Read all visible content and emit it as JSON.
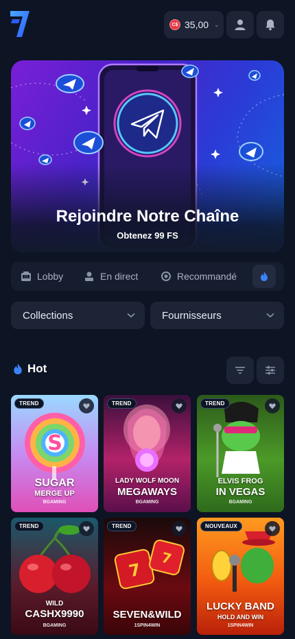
{
  "header": {
    "balance": "35,00",
    "currency_symbol": "C$"
  },
  "banner": {
    "title": "Rejoindre Notre Chaîne",
    "subtitle": "Obtenez 99 FS"
  },
  "tabs": [
    {
      "label": "Lobby",
      "icon": "slot-machine-icon"
    },
    {
      "label": "En direct",
      "icon": "dealer-icon"
    },
    {
      "label": "Recommandé",
      "icon": "medal-icon"
    },
    {
      "label": "",
      "icon": "flame-icon"
    }
  ],
  "filters": {
    "collections": "Collections",
    "providers": "Fournisseurs"
  },
  "section": {
    "title": "Hot"
  },
  "games": [
    {
      "badge": "TREND",
      "title_line1": "SUGAR",
      "title_line2": "MERGE UP",
      "provider": "BGAMING"
    },
    {
      "badge": "TREND",
      "title_line1": "LADY WOLF MOON",
      "title_line2": "MEGAWAYS",
      "provider": "BGAMING"
    },
    {
      "badge": "TREND",
      "title_line1": "ELVIS FROG",
      "title_line2": "IN VEGAS",
      "provider": "BGAMING"
    },
    {
      "badge": "TREND",
      "title_line1": "WILD",
      "title_line2": "CASHX9990",
      "provider": "BGAMING"
    },
    {
      "badge": "TREND",
      "title_line1": "",
      "title_line2": "SEVEN&WILD",
      "provider": "1SPIN4WIN"
    },
    {
      "badge": "NOUVEAUX",
      "title_line1": "LUCKY BAND",
      "title_line2": "HOLD AND WIN",
      "provider": "1SPIN4WIN"
    }
  ],
  "colors": {
    "background": "#0d1424",
    "surface": "#1c2436",
    "accent_blue": "#3b82f6",
    "coin_red": "#e63946"
  }
}
